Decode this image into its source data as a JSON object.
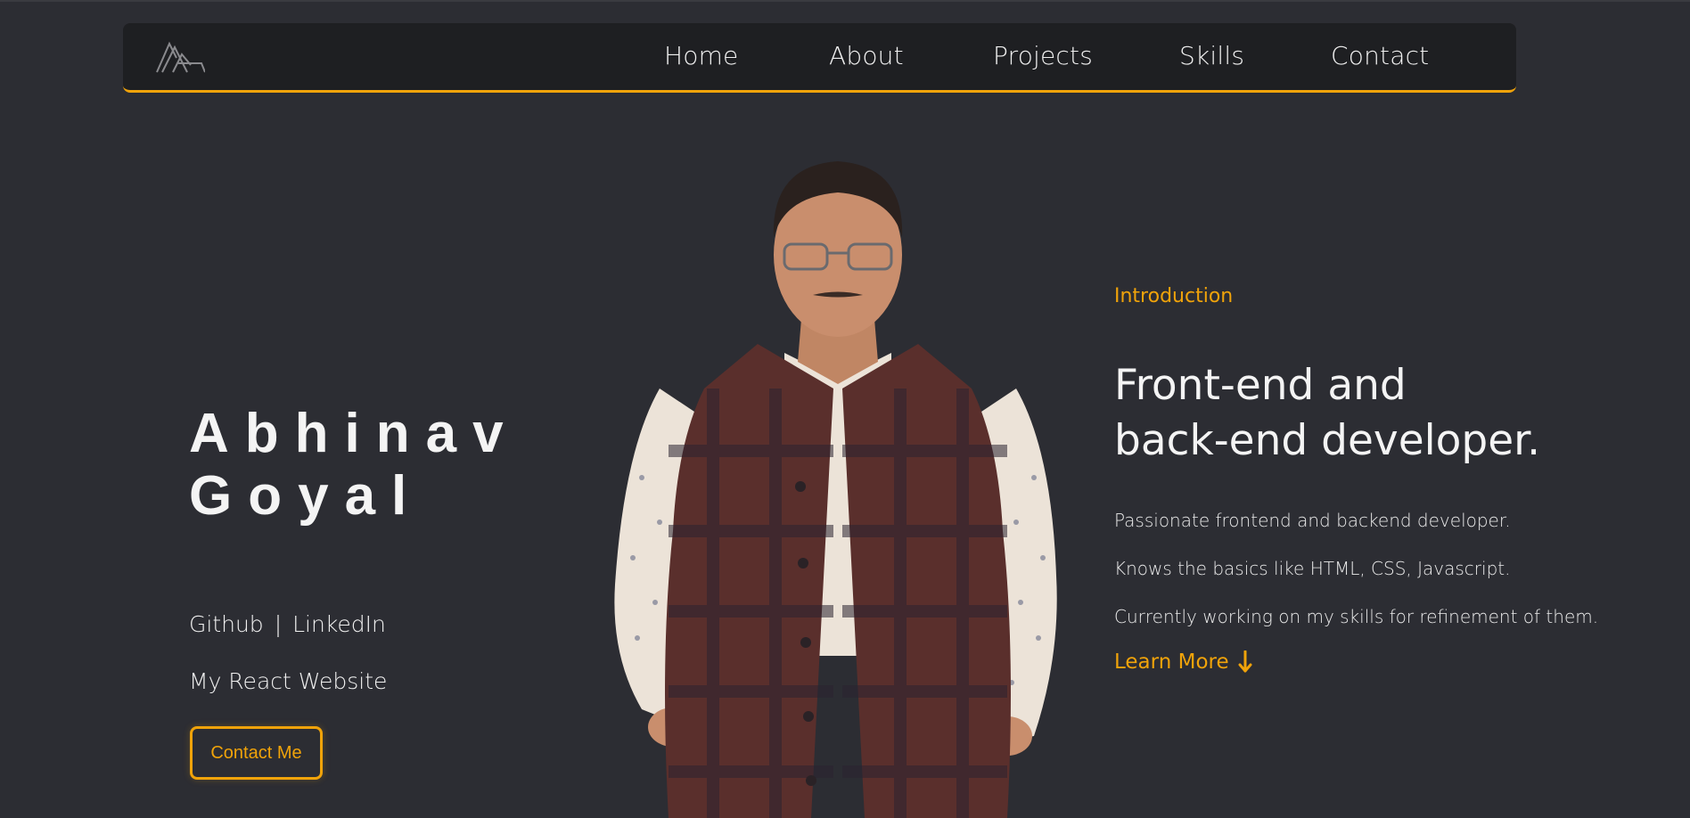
{
  "nav": {
    "logo": "AA-mountain-logo",
    "items": [
      {
        "label": "Home"
      },
      {
        "label": "About"
      },
      {
        "label": "Projects"
      },
      {
        "label": "Skills"
      },
      {
        "label": "Contact"
      }
    ]
  },
  "hero": {
    "first_name": "Abhinav",
    "last_name": "Goyal",
    "github_link": "Github",
    "separator": "|",
    "linkedin_link": "LinkedIn",
    "website_link": "My React Website",
    "contact_button": "Contact Me"
  },
  "intro": {
    "label": "Introduction",
    "headline_line1": "Front-end and",
    "headline_line2": "back-end developer.",
    "desc_1": "Passionate frontend and backend developer.",
    "desc_2": "Knows the basics like HTML, CSS, Javascript.",
    "desc_3": "Currently working on my skills for refinement of them.",
    "learn_more": "Learn More",
    "learn_more_icon": "arrow-down-icon"
  },
  "colors": {
    "background": "#2c2d33",
    "navbar": "#1e1f22",
    "accent": "#f0a30a",
    "text": "#f2f2f2"
  }
}
